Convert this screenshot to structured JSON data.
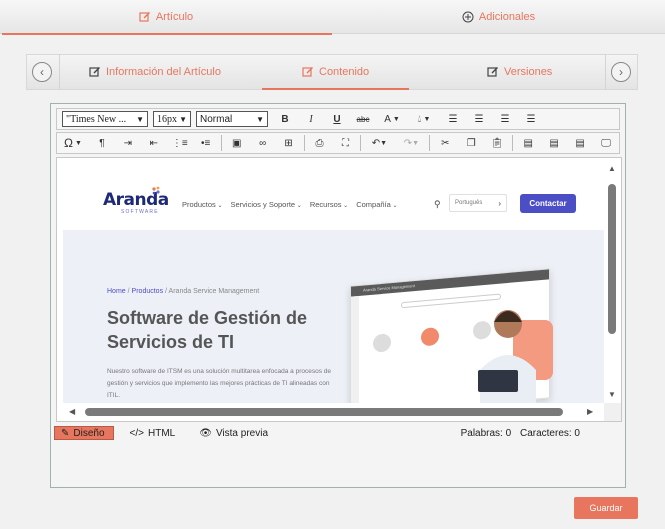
{
  "top_tabs": [
    {
      "label": "Artículo",
      "icon": "edit-icon"
    },
    {
      "label": "Adicionales",
      "icon": "plus-circle-icon"
    }
  ],
  "sub_tabs": [
    {
      "label": "Información del Artículo",
      "icon": "edit-icon"
    },
    {
      "label": "Contenido",
      "icon": "edit-icon"
    },
    {
      "label": "Versiones",
      "icon": "edit-icon"
    }
  ],
  "toolbar": {
    "font_family": "\"Times New ...",
    "font_size": "16px",
    "format": "Normal",
    "bold": "B",
    "italic": "I",
    "underline": "U",
    "strike": "abc",
    "font_color": "A",
    "special_char": "Ω",
    "paragraph": "¶"
  },
  "preview": {
    "logo_text": "Aranda",
    "logo_sub": "SOFTWARE",
    "nav": [
      "Productos",
      "Servicios y Soporte",
      "Recursos",
      "Compañía"
    ],
    "language": "Português",
    "contact": "Contactar",
    "breadcrumb": {
      "home": "Home",
      "products": "Productos",
      "current": "Aranda Service Management",
      "sep": "/"
    },
    "title": "Software de Gestión de Servicios de TI",
    "description": "Nuestro software de ITSM es una solución multitarea enfocada a procesos de gestión y servicios que implemento las mejores prácticas de TI alineadas con ITIL.",
    "mock_title": "Aranda Service Management"
  },
  "modes": [
    {
      "label": "Diseño",
      "icon": "pencil-icon"
    },
    {
      "label": "HTML",
      "icon": "code-icon"
    },
    {
      "label": "Vista previa",
      "icon": "eye-icon"
    }
  ],
  "counts": {
    "words_label": "Palabras: 0",
    "chars_label": "Caracteres: 0"
  },
  "save_label": "Guardar",
  "colors": {
    "accent": "#e8765e",
    "brand": "#4b4ec5"
  }
}
